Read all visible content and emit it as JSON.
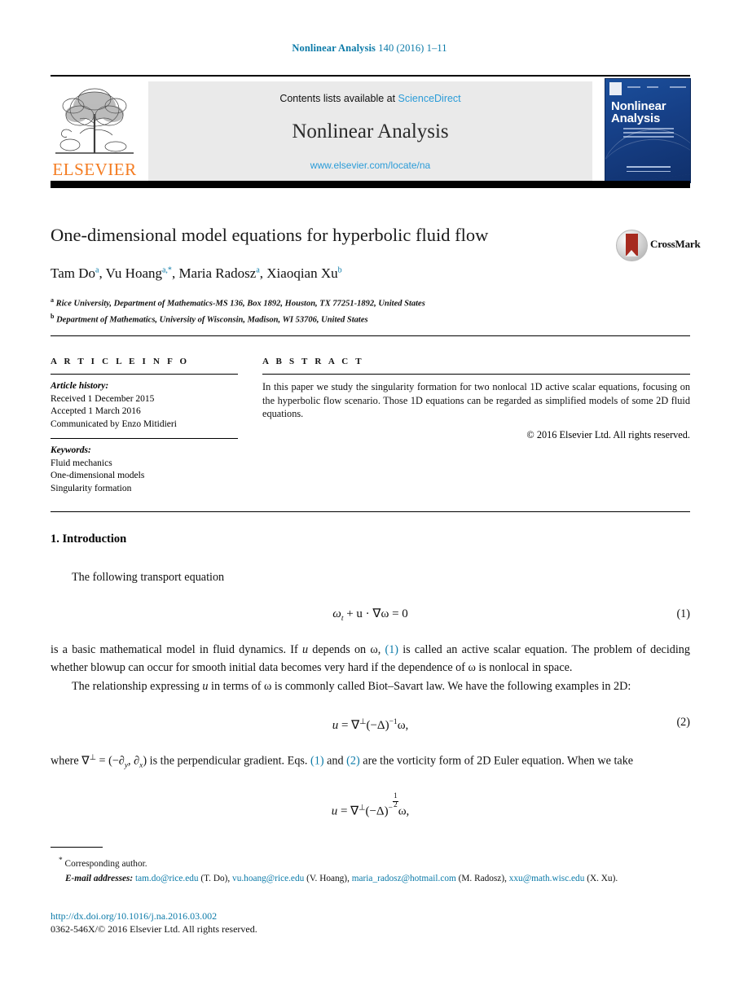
{
  "running_head": {
    "journal": "Nonlinear Analysis",
    "citation": " 140 (2016) 1–11"
  },
  "masthead": {
    "publisher_name": "ELSEVIER",
    "publisher_logo_alt": "elsevier-tree-logo",
    "contents_available": "Contents lists available at ",
    "science_direct": "ScienceDirect",
    "journal_title": "Nonlinear Analysis",
    "journal_url": "www.elsevier.com/locate/na",
    "cover_title_line1": "Nonlinear",
    "cover_title_line2": "Analysis"
  },
  "article": {
    "title": "One-dimensional model equations for hyperbolic fluid flow",
    "crossmark_label": "CrossMark",
    "authors_plain": "Tam Do, Vu Hoang, Maria Radosz, Xiaoqian Xu",
    "authors": [
      {
        "name": "Tam Do",
        "marks": "a"
      },
      {
        "name": "Vu Hoang",
        "marks": "a,*"
      },
      {
        "name": "Maria Radosz",
        "marks": "a"
      },
      {
        "name": "Xiaoqian Xu",
        "marks": "b"
      }
    ],
    "affiliations": [
      {
        "mark": "a",
        "text": "Rice University, Department of Mathematics-MS 136, Box 1892, Houston, TX 77251-1892, United States"
      },
      {
        "mark": "b",
        "text": "Department of Mathematics, University of Wisconsin, Madison, WI 53706, United States"
      }
    ]
  },
  "article_info": {
    "heading": "A R T I C L E   I N F O",
    "history_label": "Article history:",
    "history": [
      "Received 1 December 2015",
      "Accepted 1 March 2016",
      "Communicated by Enzo Mitidieri"
    ],
    "keywords_label": "Keywords:",
    "keywords": [
      "Fluid mechanics",
      "One-dimensional models",
      "Singularity formation"
    ]
  },
  "abstract": {
    "heading": "A B S T R A C T",
    "text": "In this paper we study the singularity formation for two nonlocal 1D active scalar equations, focusing on the hyperbolic flow scenario. Those 1D equations can be regarded as simplified models of some 2D fluid equations.",
    "copyright": "© 2016 Elsevier Ltd. All rights reserved."
  },
  "body": {
    "section_number_title": "1. Introduction",
    "para1": "The following transport equation",
    "equation1": {
      "lhs": "ω",
      "sub": "t",
      "rest": " + u · ∇ω = 0",
      "number": "(1)"
    },
    "para2_a": "is a basic mathematical model in fluid dynamics. If ",
    "para2_u": "u",
    "para2_b": " depends on ω, ",
    "para2_ref1": "(1)",
    "para2_c": " is called an active scalar equation. The problem of deciding whether blowup can occur for smooth initial data becomes very hard if the dependence of ω is nonlocal in space.",
    "para3_a": "The relationship expressing ",
    "para3_u": "u",
    "para3_b": " in terms of ω is commonly called Biot–Savart law. We have the following examples in 2D:",
    "equation2": {
      "text": "u = ∇⊥(−Δ)−1ω,",
      "number": "(2)"
    },
    "para4_a": "where ∇",
    "para4_b": " = (−∂",
    "para4_c": ", ∂",
    "para4_d": ") is the perpendicular gradient. Eqs. ",
    "para4_ref1": "(1)",
    "para4_and": " and ",
    "para4_ref2": "(2)",
    "para4_e": " are the vorticity form of 2D Euler equation. When we take",
    "equation3": {
      "text": "u = ∇⊥(−Δ)−1/2ω,"
    }
  },
  "footnotes": {
    "corresponding_mark": "*",
    "corresponding": "Corresponding author.",
    "email_label": "E-mail addresses:",
    "emails": [
      {
        "address": "tam.do@rice.edu",
        "person": "(T. Do),"
      },
      {
        "address": "vu.hoang@rice.edu",
        "person": "(V. Hoang),"
      },
      {
        "address": "maria_radosz@hotmail.com",
        "person": "(M. Radosz),"
      },
      {
        "address": "xxu@math.wisc.edu",
        "person": "(X. Xu)."
      }
    ],
    "doi": "http://dx.doi.org/10.1016/j.na.2016.03.002",
    "issn_copyright": "0362-546X/© 2016 Elsevier Ltd. All rights reserved."
  },
  "colors": {
    "link_blue": "#0b7aa8",
    "science_direct_blue": "#2b9cd8",
    "elsevier_orange": "#f47b20",
    "cover_blue": "#1b4f9c"
  }
}
